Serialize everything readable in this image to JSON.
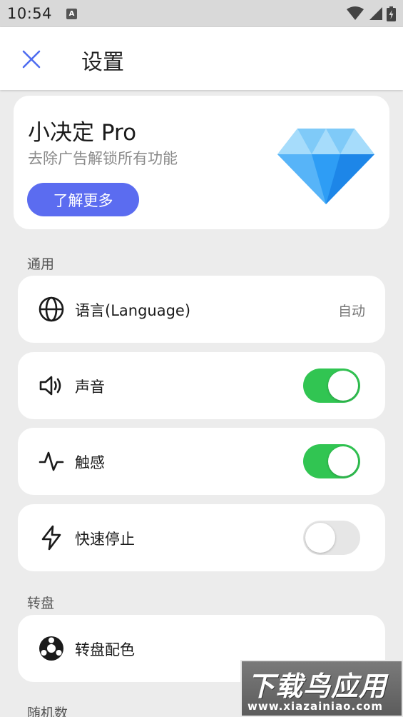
{
  "status_bar": {
    "time": "10:54",
    "badge": "A"
  },
  "app_bar": {
    "title": "设置"
  },
  "pro_card": {
    "title": "小决定 Pro",
    "subtitle": "去除广告解锁所有功能",
    "button_label": "了解更多",
    "accent_color": "#5b6cf0"
  },
  "sections": {
    "general": "通用",
    "wheel": "转盘",
    "random": "随机数"
  },
  "settings": {
    "language": {
      "label": "语言(Language)",
      "value": "自动",
      "icon": "globe-icon"
    },
    "sound": {
      "label": "声音",
      "enabled": true,
      "icon": "speaker-icon"
    },
    "haptics": {
      "label": "触感",
      "enabled": true,
      "icon": "pulse-icon"
    },
    "quick_stop": {
      "label": "快速停止",
      "enabled": false,
      "icon": "lightning-icon"
    },
    "wheel_colors": {
      "label": "转盘配色",
      "icon": "palette-icon"
    }
  },
  "watermark": {
    "title": "下载鸟应用",
    "url": "www.xiazainiao.com"
  },
  "colors": {
    "toggle_on": "#31c552",
    "toggle_off": "#e6e6e6",
    "close_icon": "#4e6cf0"
  }
}
